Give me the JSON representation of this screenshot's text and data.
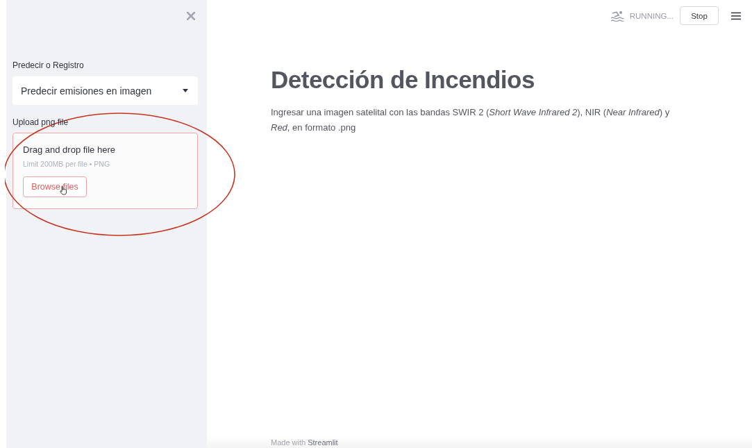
{
  "sidebar": {
    "select": {
      "label": "Predecir o Registro",
      "value": "Predecir emisiones en imagen"
    },
    "uploader": {
      "label": "Upload png file",
      "title": "Drag and drop file here",
      "hint": "Limit 200MB per file • PNG",
      "button": "Browse files"
    }
  },
  "header": {
    "status": "RUNNING...",
    "stop_button": "Stop"
  },
  "main": {
    "title": "Detección de Incendios",
    "description": "Ingresar una imagen satelital con las bandas SWIR 2 (*Short Wave Infrared 2*), NIR (*Near Infrared*) y *Red*, en formato .png"
  },
  "footer": {
    "text": "Made with",
    "link": "Streamlit"
  }
}
